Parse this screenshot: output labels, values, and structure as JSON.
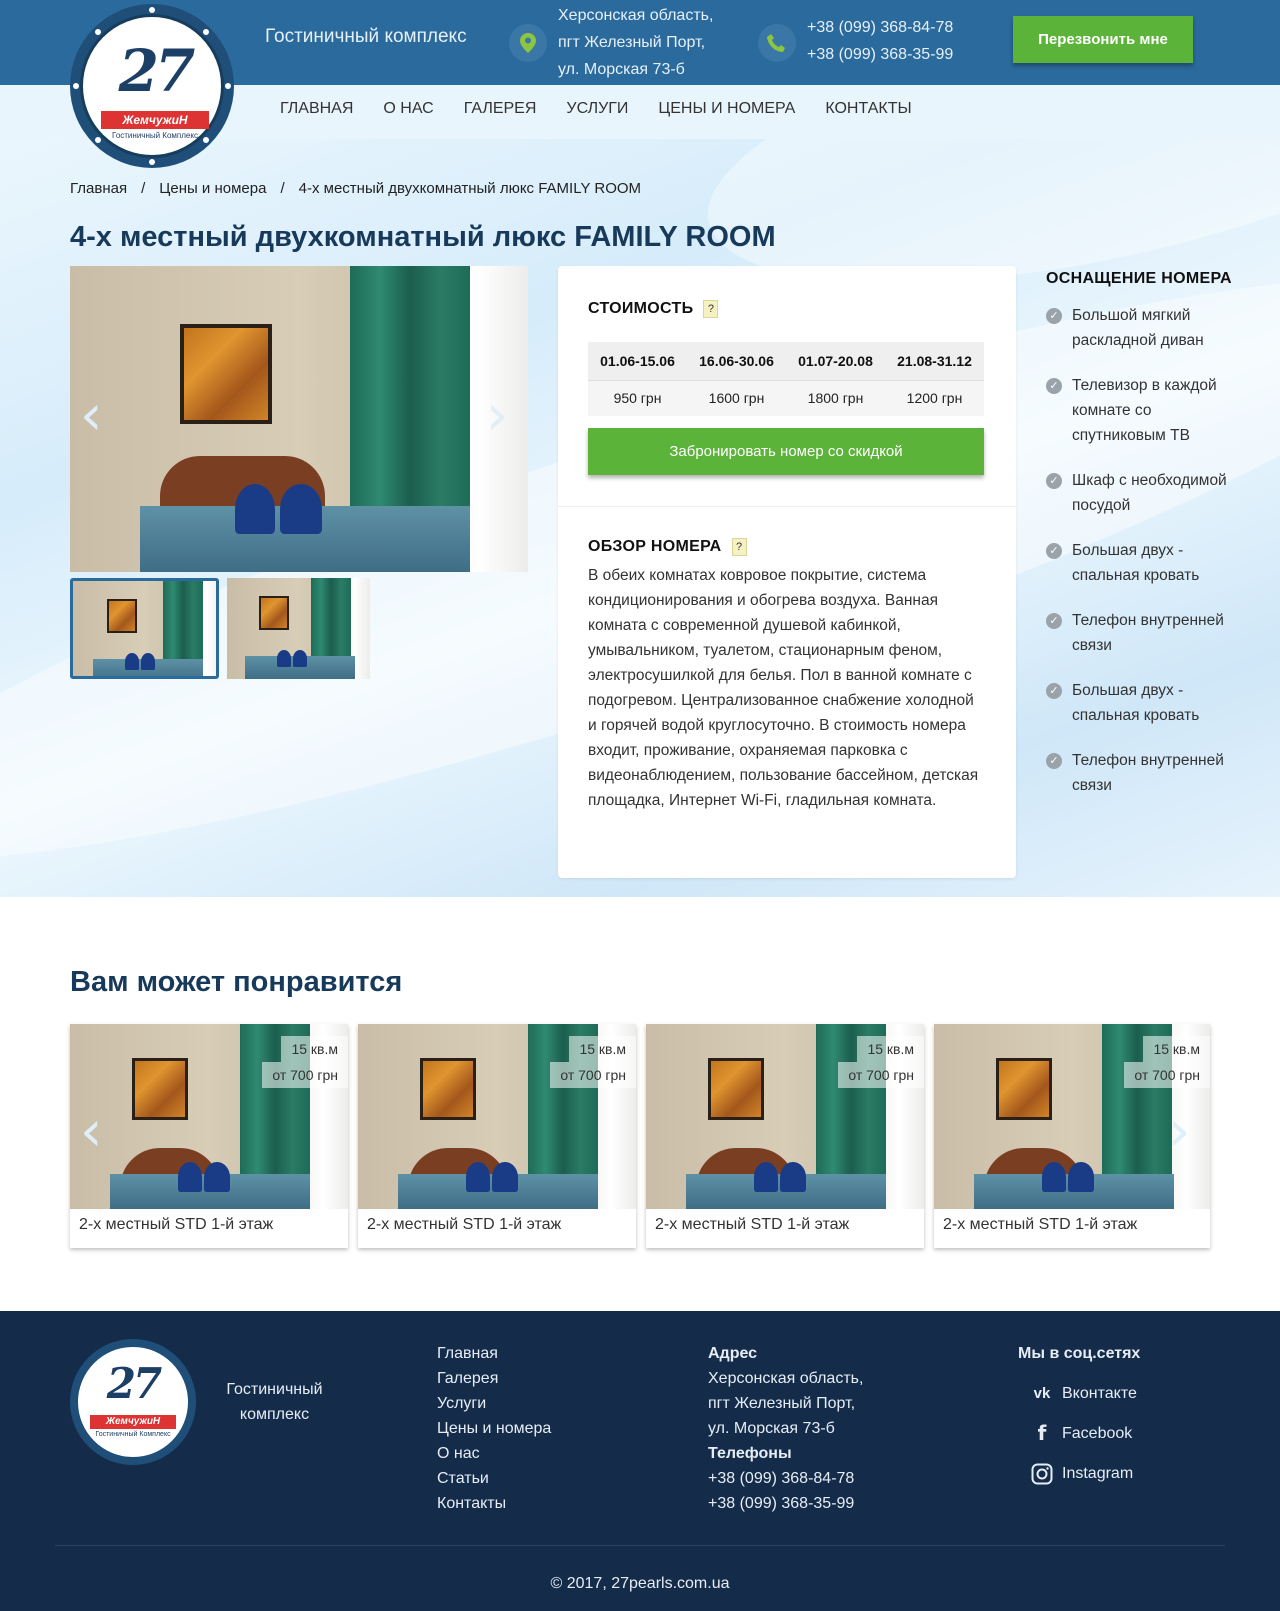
{
  "header": {
    "logo_number": "27",
    "logo_brand": "ЖемчужиН",
    "logo_sub": "Гостиничный Комплекс",
    "tagline": "Гостиничный комплекс",
    "address": [
      "Херсонская область,",
      "пгт Железный Порт,",
      "ул. Морская 73-б"
    ],
    "phones": [
      "+38 (099) 368-84-78",
      "+38 (099) 368-35-99"
    ],
    "callback_label": "Перезвонить мне"
  },
  "nav": [
    "ГЛАВНАЯ",
    "О НАС",
    "ГАЛЕРЕЯ",
    "УСЛУГИ",
    "ЦЕНЫ И НОМЕРА",
    "КОНТАКТЫ"
  ],
  "breadcrumb": [
    "Главная",
    "Цены и номера",
    "4-х местный двухкомнатный люкс FAMILY ROOM"
  ],
  "breadcrumb_sep": "/",
  "page_title": "4-х местный двухкомнатный люкс FAMILY ROOM",
  "pricing": {
    "title": "СТОИМОСТЬ",
    "help": "?",
    "periods": [
      "01.06-15.06",
      "16.06-30.06",
      "01.07-20.08",
      "21.08-31.12"
    ],
    "prices": [
      "950 грн",
      "1600 грн",
      "1800 грн",
      "1200 грн"
    ],
    "book_label": "Забронировать номер со скидкой"
  },
  "overview": {
    "title": "ОБЗОР НОМЕРА",
    "help": "?",
    "text": "В обеих комнатах ковровое покрытие, система кондиционирования и обогрева воздуха. Ванная комната с современной душевой кабинкой, умывальником, туалетом, стационарным феном, электросушилкой для белья. Пол в ванной комнате с подогревом. Централизованное снабжение холодной и горячей водой круглосуточно. В стоимость номера входит, проживание, охраняемая парковка с видеонаблюдением, пользование бассейном, детская площадка, Интернет Wi-Fi, гладильная комната."
  },
  "equipment": {
    "title": "ОСНАЩЕНИЕ НОМЕРА",
    "items": [
      "Большой мягкий раскладной диван",
      "Телевизор в каждой комнате со спутниковым ТВ",
      "Шкаф с необходимой посудой",
      "Большая двух - спальная кровать",
      "Телефон внутренней связи",
      "Большая двух - спальная кровать",
      "Телефон внутренней связи"
    ]
  },
  "related": {
    "title": "Вам может понравится",
    "cards": [
      {
        "area": "15 кв.м",
        "price": "от 700 грн",
        "name": "2-х местный STD 1-й этаж"
      },
      {
        "area": "15 кв.м",
        "price": "от 700 грн",
        "name": "2-х местный STD 1-й этаж"
      },
      {
        "area": "15 кв.м",
        "price": "от 700 грн",
        "name": "2-х местный STD 1-й этаж"
      },
      {
        "area": "15 кв.м",
        "price": "от 700 грн",
        "name": "2-х местный STD 1-й этаж"
      }
    ]
  },
  "footer": {
    "tagline": "Гостиничный комплекс",
    "links": [
      "Главная",
      "Галерея",
      "Услуги",
      "Цены и номера",
      "О нас",
      "Статьи",
      "Контакты"
    ],
    "address_title": "Адрес",
    "address": [
      "Херсонская область,",
      "пгт Железный Порт,",
      "ул. Морская 73-б"
    ],
    "phones_title": "Телефоны",
    "phones": [
      "+38 (099) 368-84-78",
      "+38 (099) 368-35-99"
    ],
    "social_title": "Мы в соц.сетях",
    "social": [
      "Вконтакте",
      "Facebook",
      "Instagram"
    ],
    "copyright": "© 2017, 27pearls.com.ua"
  },
  "colors": {
    "header": "#2b6a9c",
    "accent_green": "#5bb33a",
    "title": "#183a5a",
    "footer": "#142c4a"
  }
}
